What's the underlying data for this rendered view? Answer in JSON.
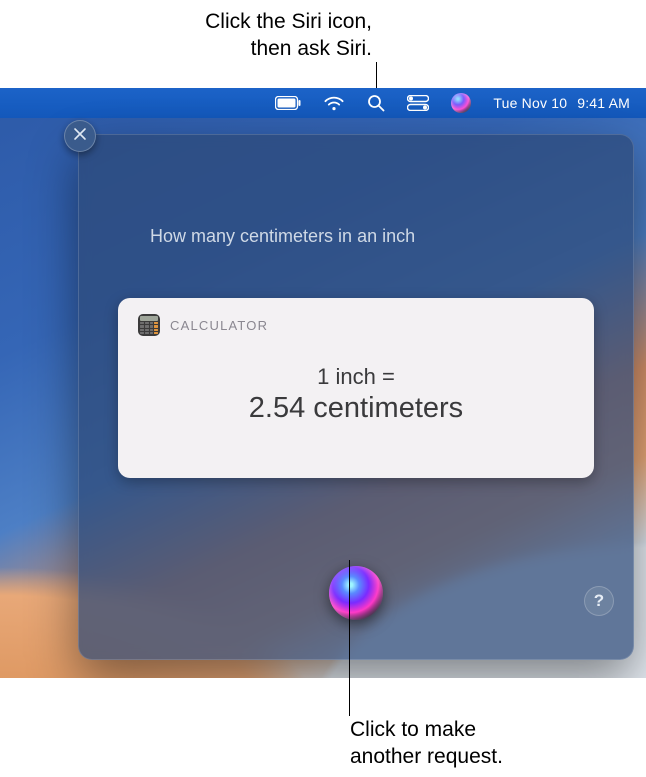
{
  "annotations": {
    "top_line1": "Click the Siri icon,",
    "top_line2": "then ask Siri.",
    "bottom_line1": "Click to make",
    "bottom_line2": "another request."
  },
  "menubar": {
    "date": "Tue Nov 10",
    "time": "9:41 AM"
  },
  "siri": {
    "query": "How many centimeters in an inch",
    "card_source": "CALCULATOR",
    "conversion_line1": "1 inch =",
    "conversion_line2": "2.54 centimeters",
    "help_label": "?"
  }
}
